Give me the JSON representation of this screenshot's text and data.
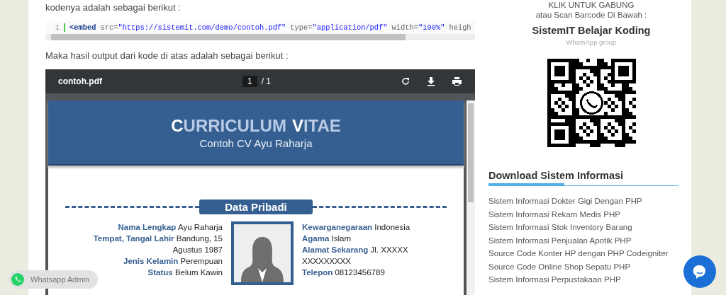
{
  "article": {
    "intro_text": "kodenya adalah sebagai berikut :",
    "code_block": {
      "line_number": "1",
      "tokens": [
        {
          "kind": "tag",
          "text": "<embed"
        },
        {
          "kind": "attr",
          "text": "src"
        },
        {
          "kind": "eq",
          "text": "="
        },
        {
          "kind": "string",
          "text": "\"https://sistemit.com/demo/contoh.pdf\""
        },
        {
          "kind": "attr",
          "text": "type"
        },
        {
          "kind": "eq",
          "text": "="
        },
        {
          "kind": "string",
          "text": "\"application/pdf\""
        },
        {
          "kind": "attr",
          "text": "width"
        },
        {
          "kind": "eq",
          "text": "="
        },
        {
          "kind": "string",
          "text": "\"100%\""
        },
        {
          "kind": "attr",
          "text": "heigh"
        }
      ]
    },
    "output_text": "Maka hasil output dari kode di atas adalah sebagai berikut :",
    "pdf_viewer": {
      "file_name": "contoh.pdf",
      "page_input": "1",
      "page_total": "/ 1",
      "document": {
        "title_words": [
          {
            "initial": "C",
            "rest": "URRICULUM"
          },
          {
            "initial": "V",
            "rest": "ITAE"
          }
        ],
        "subtitle": "Contoh CV Ayu Raharja",
        "section_title": "Data Pribadi",
        "left_fields": [
          "**Nama Lengkap** Ayu Raharja",
          "**Tempat, Tangal Lahir** Bandung, 15 Agustus 1987",
          "**Jenis Kelamin** Perempuan",
          "**Status** Belum Kawin"
        ],
        "right_fields": [
          "**Kewarganegaraan** Indonesia",
          "**Agama** Islam",
          "**Alamat Sekarang** Jl. XXXXX XXXXXXXXX",
          "**Telepon** 08123456789"
        ]
      }
    }
  },
  "sidebar": {
    "join_prompt": "KLIK UNTUK GABUNG",
    "scan_text": "atau Scan Barcode Di Bawah :",
    "group_name": "SistemIT Belajar Koding",
    "group_subtitle": "WhatsApp group",
    "widget_title": "Download Sistem Informasi",
    "links": [
      "Sistem Informasi Dokter Gigi Dengan PHP",
      "Sistem Informasi Rekam Medis PHP",
      "Sistem Informasi Stok Inventory Barang",
      "Sistem Informasi Penjualan Apotik PHP",
      "Source Code Konter HP dengan PHP Codeigniter",
      "Source Code Online Shop Sepatu PHP",
      "Sistem Informasi Perpustakaan PHP"
    ]
  },
  "whatsapp_button": {
    "label": "Whatsapp Admin"
  }
}
